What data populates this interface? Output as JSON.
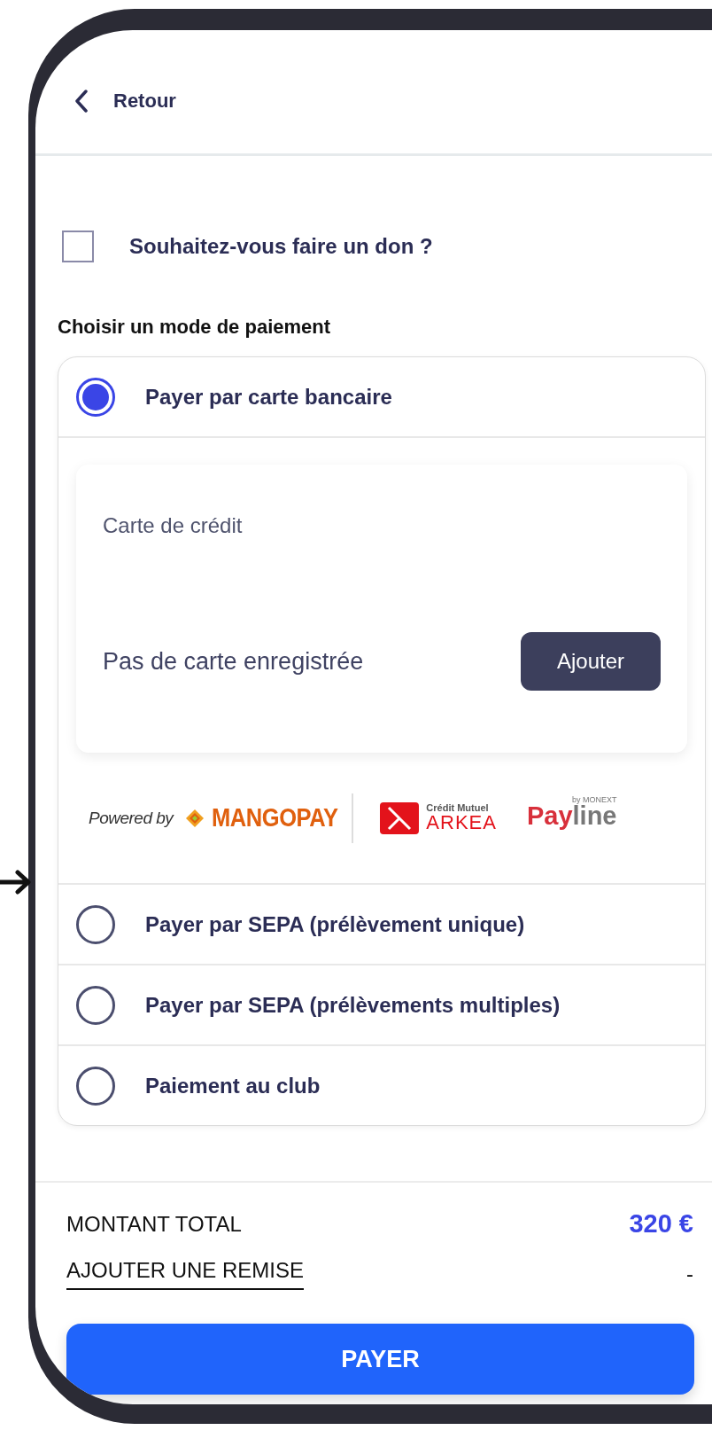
{
  "header": {
    "back_label": "Retour"
  },
  "donation": {
    "label": "Souhaitez-vous faire un don ?",
    "checked": false
  },
  "payment": {
    "title": "Choisir un mode de paiement",
    "methods": [
      {
        "label": "Payer par carte bancaire",
        "selected": true
      },
      {
        "label": "Payer par SEPA (prélèvement unique)",
        "selected": false
      },
      {
        "label": "Payer par SEPA (prélèvements multiples)",
        "selected": false
      },
      {
        "label": "Paiement au club",
        "selected": false
      }
    ]
  },
  "card_panel": {
    "title": "Carte de crédit",
    "empty_text": "Pas de carte enregistrée",
    "add_button": "Ajouter"
  },
  "partners": {
    "powered_by": "Powered by",
    "mangopay": "MANGOPAY",
    "arkea_top": "Crédit Mutuel",
    "arkea": "ARKEA",
    "payline_pay": "Pay",
    "payline_line": "line",
    "payline_by": "by MONEXT"
  },
  "summary": {
    "total_label": "MONTANT TOTAL",
    "total_value": "320 €",
    "discount_link": "AJOUTER UNE REMISE",
    "discount_value": "-"
  },
  "pay_button": "PAYER"
}
